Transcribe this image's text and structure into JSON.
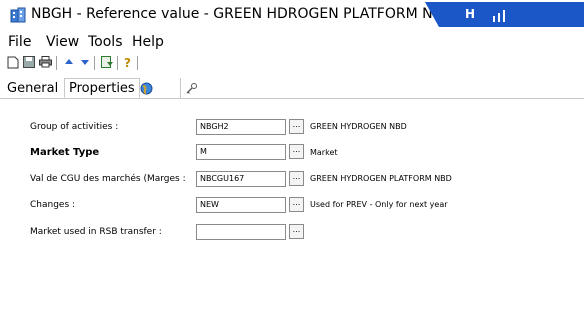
{
  "window": {
    "title": "NBGH - Reference value - GREEN HDROGEN PLATFORM NBD",
    "banner_text": "H",
    "accent": "#1c57c8"
  },
  "menu": [
    "File",
    "View",
    "Tools",
    "Help"
  ],
  "toolbar": {
    "icons": [
      "new-icon",
      "save-icon",
      "print-icon",
      "arrow-up-icon",
      "arrow-down-icon",
      "export-icon",
      "help-icon"
    ]
  },
  "tabs": [
    {
      "label": "General",
      "active": false
    },
    {
      "label": "Properties",
      "active": true
    },
    {
      "label": "",
      "icon": "globe-icon"
    },
    {
      "label": "",
      "icon": "key-icon"
    }
  ],
  "form": {
    "rows": [
      {
        "label": "Group of activities :",
        "value": "NBGH2",
        "desc": "GREEN HYDROGEN NBD",
        "bold": false
      },
      {
        "label": "Market Type",
        "value": "M",
        "desc": "Market",
        "bold": true
      },
      {
        "label": "Val de CGU des marchés (Marges :",
        "value": "NBCGU167",
        "desc": "GREEN HYDROGEN PLATFORM NBD",
        "bold": false
      },
      {
        "label": "Changes :",
        "value": "NEW",
        "desc": "Used for PREV - Only for next year",
        "bold": false
      },
      {
        "label": "Market used in RSB transfer :",
        "value": "",
        "desc": "",
        "bold": false
      }
    ],
    "button_label": "..."
  }
}
